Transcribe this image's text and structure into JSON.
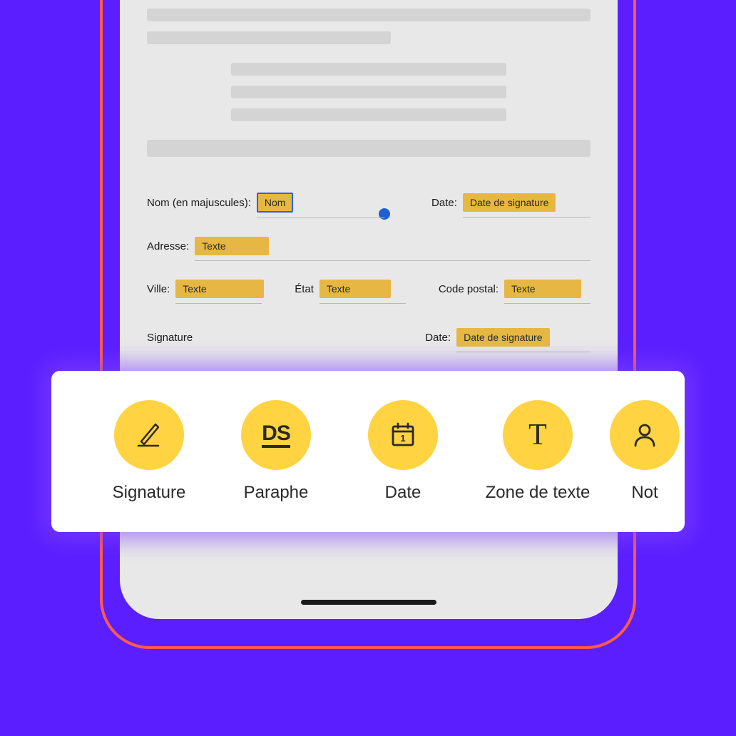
{
  "form": {
    "labels": {
      "name": "Nom (en majuscules):",
      "date": "Date:",
      "address": "Adresse:",
      "city": "Ville:",
      "state": "État",
      "postal": "Code postal:",
      "signature": "Signature",
      "date2": "Date:"
    },
    "fields": {
      "name_tag": "Nom",
      "date_tag": "Date de signature",
      "address_tag": "Texte",
      "city_tag": "Texte",
      "state_tag": "Texte",
      "postal_tag": "Texte",
      "date2_tag": "Date de signature"
    }
  },
  "toolbar": {
    "items": [
      {
        "label": "Signature",
        "icon": "signature"
      },
      {
        "label": "Paraphe",
        "icon": "initials"
      },
      {
        "label": "Date",
        "icon": "date"
      },
      {
        "label": "Zone de texte",
        "icon": "text"
      },
      {
        "label": "Not",
        "icon": "person"
      }
    ]
  },
  "colors": {
    "background": "#5B1FFF",
    "accent_outline": "#FF5B4A",
    "field_tag": "#E6B843",
    "toolbar_icon_bg": "#FFD341",
    "selection": "#2563eb"
  }
}
